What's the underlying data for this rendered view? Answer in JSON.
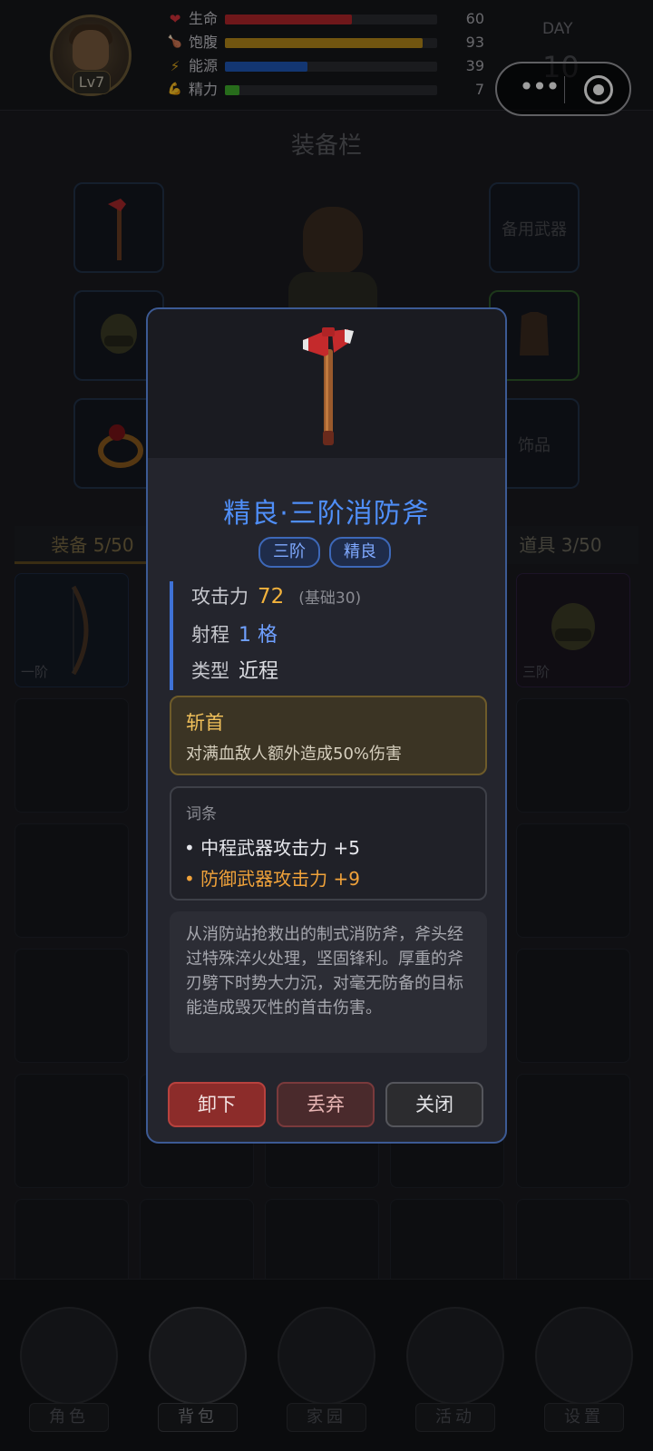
{
  "player": {
    "level": "Lv7",
    "stats": [
      {
        "label": "生命",
        "value": "60",
        "fill": 0.6,
        "color": "#b3262a",
        "icon": "heart-icon",
        "glyph": "❤"
      },
      {
        "label": "饱腹",
        "value": "93",
        "fill": 0.93,
        "color": "#b78a1a",
        "icon": "food-icon",
        "glyph": "🍗"
      },
      {
        "label": "能源",
        "value": "39",
        "fill": 0.39,
        "color": "#1f57b8",
        "icon": "lightning-icon",
        "glyph": "⚡"
      },
      {
        "label": "精力",
        "value": "7",
        "fill": 0.07,
        "color": "#3fae2d",
        "icon": "muscle-icon",
        "glyph": "💪"
      }
    ],
    "day_label": "DAY",
    "day_number": "10"
  },
  "equipment": {
    "title": "装备栏",
    "spare_weapon_label": "备用武器",
    "accessory_label": "饰品"
  },
  "inventory": {
    "tab_equipment": "装备 5/50",
    "tab_items": "道具 3/50",
    "cell_tier_1": "一阶",
    "cell_tier_3": "三阶"
  },
  "nav": {
    "character": "角色",
    "backpack": "背包",
    "home": "家园",
    "events": "活动",
    "settings": "设置"
  },
  "item": {
    "title": "精良·三阶消防斧",
    "tags": [
      "三阶",
      "精良"
    ],
    "attack_label": "攻击力",
    "attack_value": "72",
    "attack_base": "(基础30)",
    "range_label": "射程",
    "range_value": "1 格",
    "type_label": "类型",
    "type_value": "近程",
    "skill_name": "斩首",
    "skill_desc": "对满血敌人额外造成50%伤害",
    "affix_title": "词条",
    "affixes": [
      {
        "text": "• 中程武器攻击力 +5",
        "color": "white"
      },
      {
        "text": "• 防御武器攻击力 +9",
        "color": "orange"
      }
    ],
    "lore": "从消防站抢救出的制式消防斧，斧头经过特殊淬火处理，坚固锋利。厚重的斧刃劈下时势大力沉，对毫无防备的目标能造成毁灭性的首击伤害。"
  },
  "buttons": {
    "unequip": "卸下",
    "discard": "丢弃",
    "close": "关闭"
  },
  "colors": {
    "accent": "#4f8ef7",
    "modal_border": "#3c5a94",
    "skill_gold": "#f0c05a",
    "affix_orange": "#f0a23a"
  }
}
